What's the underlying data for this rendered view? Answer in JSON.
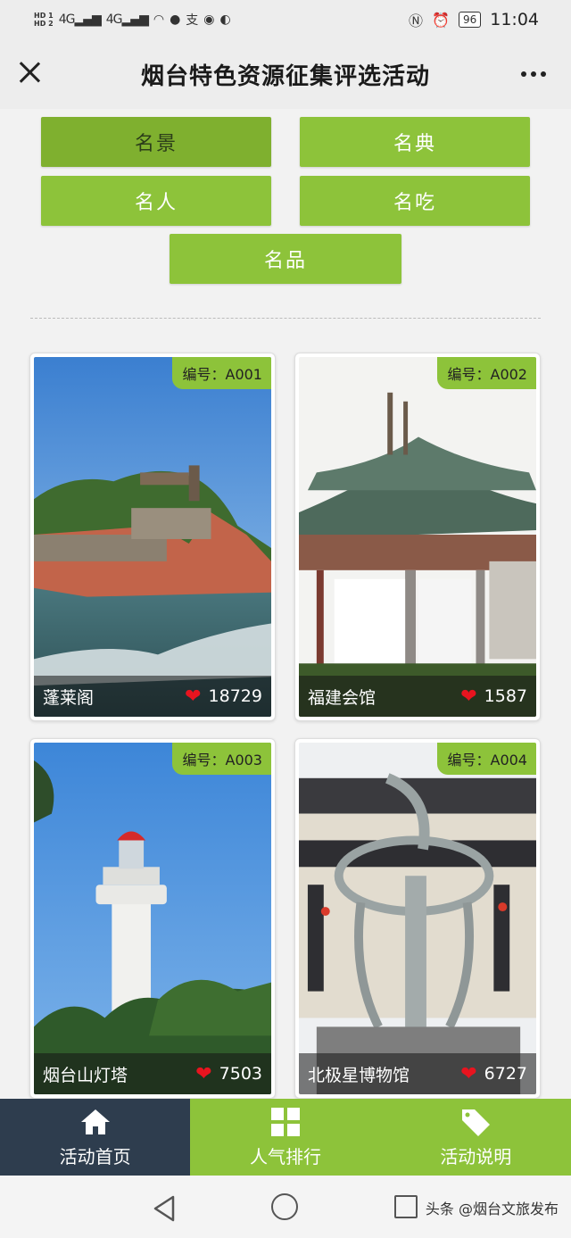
{
  "status_bar": {
    "hd1": "HD 1",
    "hd2": "HD 2",
    "signal1": "4G",
    "signal2": "4G",
    "alipay": "支",
    "battery": "96",
    "time": "11:04"
  },
  "header": {
    "title": "烟台特色资源征集评选活动"
  },
  "categories": [
    {
      "label": "名景",
      "active": true
    },
    {
      "label": "名典",
      "active": false
    },
    {
      "label": "名人",
      "active": false
    },
    {
      "label": "名吃",
      "active": false
    },
    {
      "label": "名品",
      "active": false
    }
  ],
  "cards": [
    {
      "code": "编号：A001",
      "name": "蓬莱阁",
      "votes": "18729"
    },
    {
      "code": "编号：A002",
      "name": "福建会馆",
      "votes": "1587"
    },
    {
      "code": "编号：A003",
      "name": "烟台山灯塔",
      "votes": "7503"
    },
    {
      "code": "编号：A004",
      "name": "北极星博物馆",
      "votes": "6727"
    }
  ],
  "tabs": [
    {
      "label": "活动首页",
      "icon": "home-icon"
    },
    {
      "label": "人气排行",
      "icon": "grid-icon"
    },
    {
      "label": "活动说明",
      "icon": "tag-icon"
    }
  ],
  "watermark": "头条 @烟台文旅发布",
  "colors": {
    "accent": "#8dc33a",
    "tab_active": "#2e3d4e",
    "heart": "#e8141f"
  }
}
